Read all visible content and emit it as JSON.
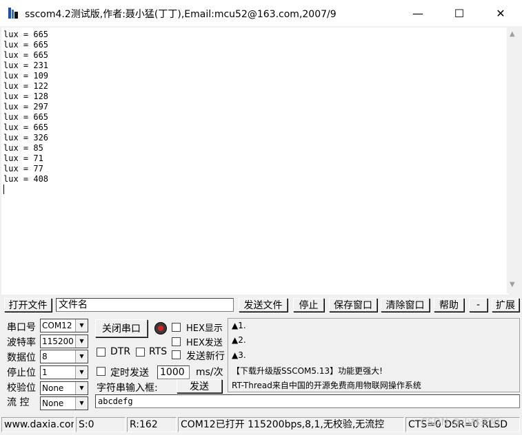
{
  "window": {
    "title": "sscom4.2测试版,作者:聂小猛(丁丁),Email:mcu52@163.com,2007/9",
    "minimize_glyph": "—",
    "maximize_glyph": "☐",
    "close_glyph": "✕"
  },
  "output": {
    "lines": [
      "lux = 665",
      "lux = 665",
      "lux = 665",
      "lux = 231",
      "lux = 109",
      "lux = 122",
      "lux = 128",
      "lux = 297",
      "lux = 665",
      "lux = 665",
      "lux = 326",
      "lux = 85",
      "lux = 71",
      "lux = 77",
      "lux = 408"
    ]
  },
  "toolbar": {
    "open_file": "打开文件",
    "filename": "文件名",
    "send_file": "发送文件",
    "stop": "停止",
    "save_window": "保存窗口",
    "clear_window": "清除窗口",
    "help": "帮助",
    "minus": "-",
    "expand": "扩展"
  },
  "settings": {
    "port_label": "串口号",
    "port_value": "COM12",
    "baud_label": "波特率",
    "baud_value": "115200",
    "databits_label": "数据位",
    "databits_value": "8",
    "stopbits_label": "停止位",
    "stopbits_value": "1",
    "parity_label": "校验位",
    "parity_value": "None",
    "flow_label": "流 控",
    "flow_value": "None"
  },
  "controls": {
    "close_port": "关闭串口",
    "hex_display": "HEX显示",
    "hex_send": "HEX发送",
    "dtr": "DTR",
    "rts": "RTS",
    "send_newline": "发送新行",
    "timed_send": "定时发送",
    "interval": "1000",
    "interval_unit": "ms/次",
    "string_input_label": "字符串输入框:",
    "send": "发送",
    "input_value": "abcdefg"
  },
  "panel": {
    "item1": "▲1.",
    "item2": "▲2.",
    "item3": "▲3.",
    "ad1": "【下载升级版SSCOM5.13】功能更强大!",
    "ad2": "RT-Thread来自中国的开源免费商用物联网操作系统"
  },
  "statusbar": {
    "website": "www.daxia.com",
    "sent": "S:0",
    "received": "R:162",
    "port_status": "COM12已打开  115200bps,8,1,无校验,无流控",
    "signals": "CTS=0 DSR=0 RLSD"
  },
  "watermark": "CSDN @小林夫阳"
}
